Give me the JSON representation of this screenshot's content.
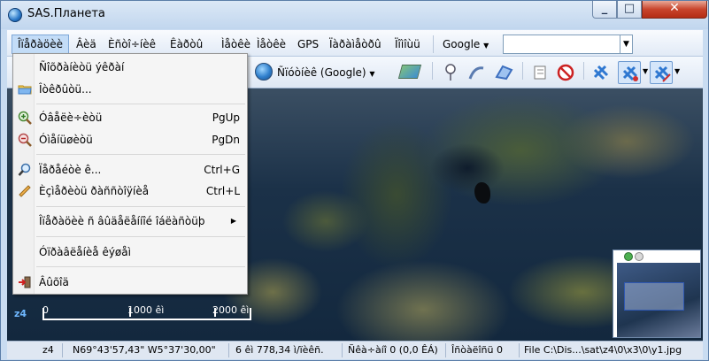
{
  "window": {
    "title": "SAS.Планета",
    "minimize_glyph": "_",
    "maximize_glyph": "□",
    "close_glyph": "✕"
  },
  "menubar": {
    "items": [
      {
        "label": "Îïåðàöèè"
      },
      {
        "label": "Âèä"
      },
      {
        "label": "Èñòî÷íèê"
      },
      {
        "label": "Êàðòû"
      },
      {
        "label": "Ìåòêè"
      },
      {
        "label": "Ìåòêè"
      },
      {
        "label": "GPS"
      },
      {
        "label": "Ïàðàìåòðû"
      },
      {
        "label": "Ïîìîùü"
      }
    ],
    "search_provider": "Google",
    "search_value": ""
  },
  "toolbar": {
    "map_source": "Ñïóòíèê (Google)"
  },
  "dropdown": {
    "items": [
      {
        "label": "Ñîõðàíèòü ýêðàí",
        "shortcut": "",
        "icon": ""
      },
      {
        "label": "Îòêðûòü...",
        "shortcut": "",
        "icon": "folder-icon"
      },
      {
        "label": "Óâåëè÷èòü",
        "shortcut": "PgUp",
        "icon": "zoom-in-icon"
      },
      {
        "label": "Óìåíüøèòü",
        "shortcut": "PgDn",
        "icon": "zoom-out-icon"
      },
      {
        "label": "Ïåðåéòè ê...",
        "shortcut": "Ctrl+G",
        "icon": "search-icon"
      },
      {
        "label": "Èçìåðèòü ðàññòîÿíèå",
        "shortcut": "Ctrl+L",
        "icon": "ruler-icon"
      },
      {
        "label": "Îïåðàöèè ñ âûäåëåííîé îáëàñòüþ",
        "shortcut": "",
        "icon": ""
      },
      {
        "label": "Óïðàâëåíèå êýøåì",
        "shortcut": "",
        "icon": ""
      },
      {
        "label": "Âûõîä",
        "shortcut": "",
        "icon": "exit-icon"
      }
    ]
  },
  "map": {
    "zoom_badge": "z4",
    "scale_labels": [
      "0",
      "1000 êì",
      "2000 êì"
    ]
  },
  "status": {
    "zoom": "z4",
    "coords": "N69°43'57,43\" W5°37'30,00\"",
    "scale": "6 êì 778,34 ì/ïèêñ.",
    "queue": "Ñêà÷àíî 0 (0,0 ÊÁ)",
    "tiles": "Îñòàëîñü 0",
    "file": "File C:\\Dis...\\sat\\z4\\0\\x3\\0\\y1.jpg"
  }
}
